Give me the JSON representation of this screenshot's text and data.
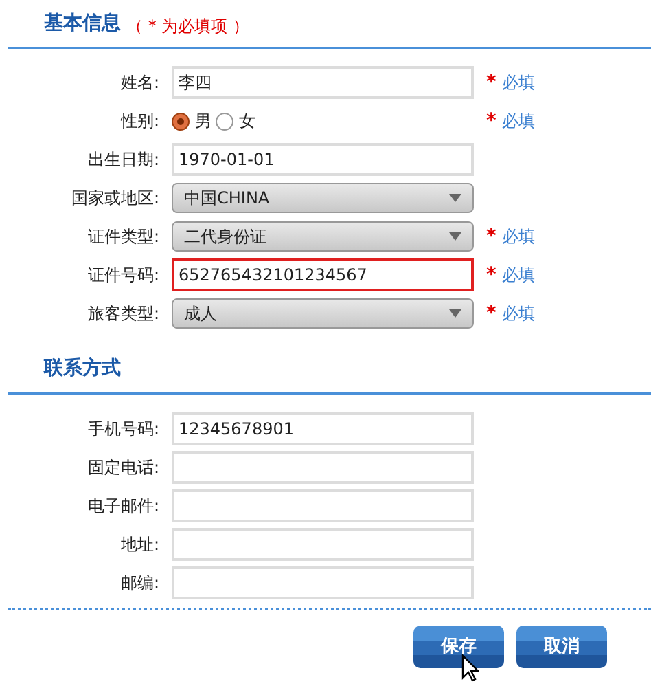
{
  "sections": [
    {
      "title": "基本信息",
      "note": "（ * 为必填项 ）",
      "fields": [
        {
          "kind": "text",
          "label": "姓名:",
          "value": "李四",
          "invalid": false,
          "required": {
            "mark": "*",
            "text": "必填"
          }
        },
        {
          "kind": "radio",
          "label": "性别:",
          "options": [
            {
              "label": "男",
              "selected": true
            },
            {
              "label": "女",
              "selected": false
            }
          ],
          "required": {
            "mark": "*",
            "text": "必填"
          }
        },
        {
          "kind": "text",
          "label": "出生日期:",
          "value": "1970-01-01",
          "invalid": false
        },
        {
          "kind": "select",
          "label": "国家或地区:",
          "value": "中国CHINA"
        },
        {
          "kind": "select",
          "label": "证件类型:",
          "value": "二代身份证",
          "required": {
            "mark": "*",
            "text": "必填"
          }
        },
        {
          "kind": "text",
          "label": "证件号码:",
          "value": "652765432101234567",
          "invalid": true,
          "required": {
            "mark": "*",
            "text": "必填"
          }
        },
        {
          "kind": "select",
          "label": "旅客类型:",
          "value": "成人",
          "required": {
            "mark": "*",
            "text": "必填"
          }
        }
      ]
    },
    {
      "title": "联系方式",
      "fields": [
        {
          "kind": "text",
          "label": "手机号码:",
          "value": "12345678901",
          "invalid": false
        },
        {
          "kind": "text",
          "label": "固定电话:",
          "invalid": false
        },
        {
          "kind": "text",
          "label": "电子邮件:",
          "invalid": false
        },
        {
          "kind": "text",
          "label": "地址:",
          "invalid": false
        },
        {
          "kind": "text",
          "label": "邮编:",
          "invalid": false
        }
      ]
    }
  ],
  "buttons": [
    "保存",
    "取消"
  ]
}
